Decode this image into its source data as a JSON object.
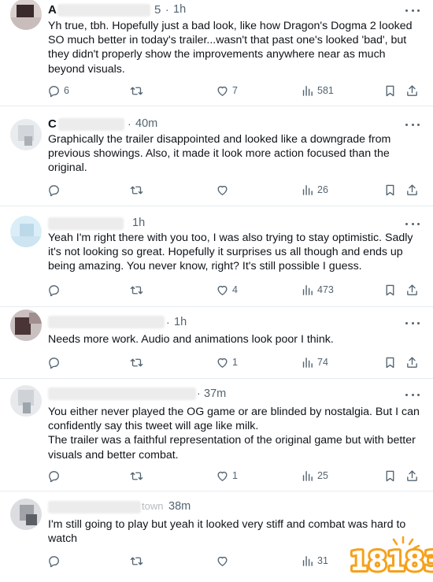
{
  "colors": {
    "text": "#0f1419",
    "muted": "#536471",
    "divider": "#e6ecf0",
    "watermark_orange": "#f5a11c"
  },
  "icons": {
    "reply": "reply-icon",
    "retweet": "retweet-icon",
    "like": "like-icon",
    "views": "views-icon",
    "bookmark": "bookmark-icon",
    "share": "share-icon",
    "more": "more-icon"
  },
  "tweets": [
    {
      "name_initial": "A",
      "name_suffix": "5",
      "time": "1h",
      "text": "Yh true, tbh. Hopefully just a bad look, like how Dragon's Dogma 2 looked SO much better in today's trailer...wasn't that past one's looked 'bad', but they didn't properly show the improvements anywhere near as much beyond visuals.",
      "replies": "6",
      "retweets": "",
      "likes": "7",
      "views": "581"
    },
    {
      "name_initial": "C",
      "name_suffix": "",
      "time": "40m",
      "text": "Graphically the trailer disappointed and looked like a downgrade from previous showings.  Also, it made it look more action focused than the original.",
      "replies": "",
      "retweets": "",
      "likes": "",
      "views": "26"
    },
    {
      "name_initial": "",
      "name_suffix": "",
      "time": "1h",
      "text": "Yeah I'm right there with you too, I was also trying to stay optimistic. Sadly it's not looking so great. Hopefully it surprises us all though and ends up being amazing. You never know, right? It's still possible I guess.",
      "replies": "",
      "retweets": "",
      "likes": "4",
      "views": "473"
    },
    {
      "name_initial": "",
      "name_suffix": "",
      "time": "1h",
      "text": "Needs more work. Audio and animations look poor I think.",
      "replies": "",
      "retweets": "",
      "likes": "1",
      "views": "74"
    },
    {
      "name_initial": "",
      "name_suffix": "",
      "time": "37m",
      "text": "You either never played the OG game or are blinded by nostalgia. But I can confidently say this tweet will age like milk.\nThe trailer was a faithful representation of the original game but with better visuals and better combat.",
      "replies": "",
      "retweets": "",
      "likes": "1",
      "views": "25"
    },
    {
      "name_initial": "",
      "name_suffix": "town",
      "time": "38m",
      "text": "I'm still going to play but yeah it looked very stiff and combat was hard to watch",
      "replies": "",
      "retweets": "",
      "likes": "",
      "views": "31"
    }
  ],
  "watermark": {
    "text": "18183"
  }
}
